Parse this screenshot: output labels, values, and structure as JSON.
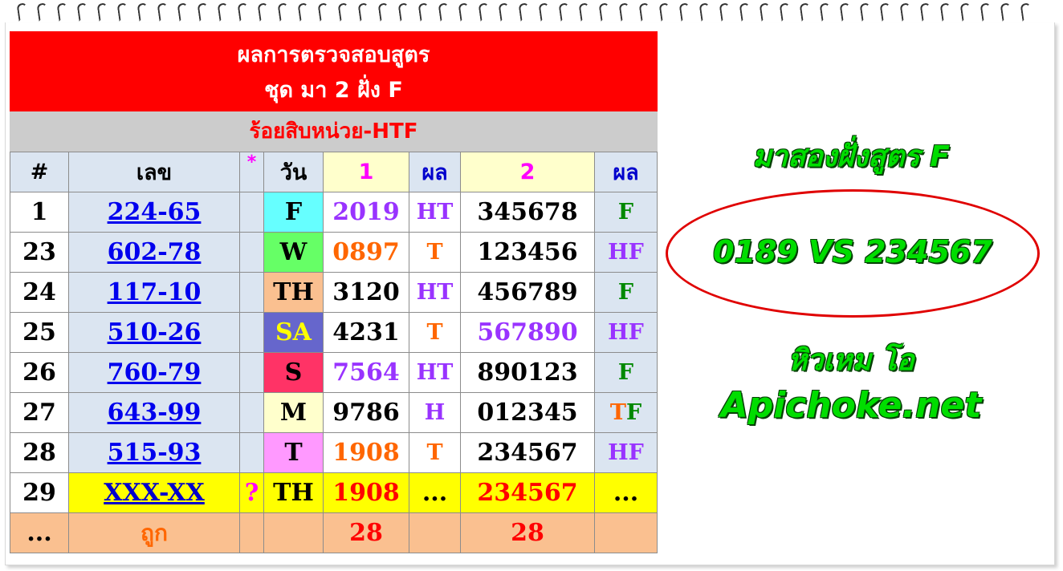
{
  "title_line1": "ผลการตรวจสอบสูตร",
  "title_line2": "ชุด มา 2 ฝั่ง F",
  "subtitle": "ร้อยสิบหน่วย-HTF",
  "header": {
    "no": "#",
    "number": "เลข",
    "star": "*",
    "day": "วัน",
    "set1": "1",
    "res1": "ผล",
    "set2": "2",
    "res2": "ผล"
  },
  "rows": [
    {
      "no": "1",
      "number": "224-65",
      "star": "",
      "day": "F",
      "set1": "2019",
      "res1": "HT",
      "set2": "345678",
      "res2": "F"
    },
    {
      "no": "23",
      "number": "602-78",
      "star": "",
      "day": "W",
      "set1": "0897",
      "res1": "T",
      "set2": "123456",
      "res2": "HF"
    },
    {
      "no": "24",
      "number": "117-10",
      "star": "",
      "day": "TH",
      "set1": "3120",
      "res1": "HT",
      "set2": "456789",
      "res2": "F"
    },
    {
      "no": "25",
      "number": "510-26",
      "star": "",
      "day": "SA",
      "set1": "4231",
      "res1": "T",
      "set2": "567890",
      "res2": "HF"
    },
    {
      "no": "26",
      "number": "760-79",
      "star": "",
      "day": "S",
      "set1": "7564",
      "res1": "HT",
      "set2": "890123",
      "res2": "F"
    },
    {
      "no": "27",
      "number": "643-99",
      "star": "",
      "day": "M",
      "set1": "9786",
      "res1": "H",
      "set2": "012345",
      "res2": "TF"
    },
    {
      "no": "28",
      "number": "515-93",
      "star": "",
      "day": "T",
      "set1": "1908",
      "res1": "T",
      "set2": "234567",
      "res2": "HF"
    },
    {
      "no": "29",
      "number": "XXX-XX",
      "star": "?",
      "day": "TH",
      "set1": "1908",
      "res1": "...",
      "set2": "234567",
      "res2": "..."
    }
  ],
  "footer": {
    "no": "...",
    "label": "ถูก",
    "count1": "28",
    "count2": "28"
  },
  "right": {
    "line1": "มาสองฝั่งสูตร F",
    "highlight": "0189 VS 234567",
    "author": "หิวเหม โอ",
    "site": "Apichoke.net"
  },
  "colors": {
    "title_bg": "#ff0000",
    "subtitle_bg": "#cccccc",
    "header_bg": "#dbe5f1",
    "footer_bg": "#fac090",
    "last_row_bg": "#ffff00",
    "green_text": "#00dd00"
  }
}
